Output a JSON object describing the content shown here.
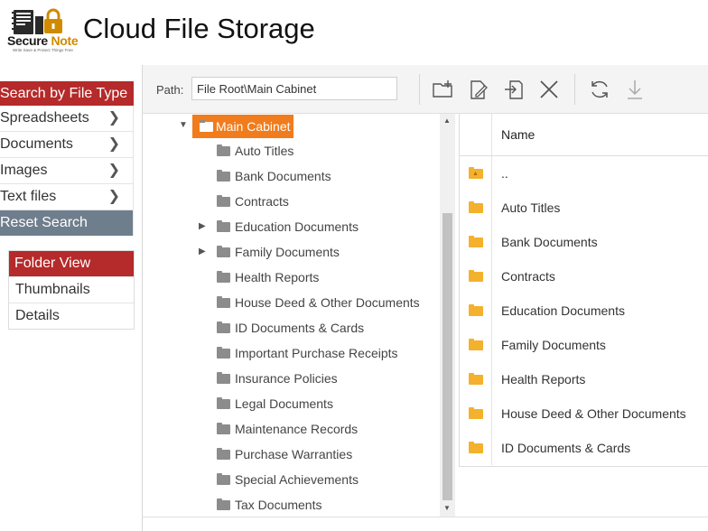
{
  "header": {
    "logo_word1": "Secure",
    "logo_word2": "Note",
    "logo_tagline": "Write Save & Protect Things Free",
    "title": "Cloud File Storage"
  },
  "search_menu": {
    "heading": "Search by File Type",
    "items": [
      {
        "label": "Spreadsheets"
      },
      {
        "label": "Documents"
      },
      {
        "label": "Images"
      },
      {
        "label": "Text files"
      }
    ],
    "reset_label": "Reset Search"
  },
  "view_menu": {
    "heading": "Folder View",
    "items": [
      {
        "label": "Thumbnails"
      },
      {
        "label": "Details"
      }
    ]
  },
  "toolbar": {
    "path_label": "Path:",
    "path_value": "File Root\\Main Cabinet",
    "buttons": [
      "new-folder-icon",
      "rename-icon",
      "move-icon",
      "delete-icon",
      "refresh-icon",
      "download-icon"
    ]
  },
  "tree": {
    "root": "Main Cabinet",
    "children": [
      {
        "label": "Auto Titles",
        "expandable": false
      },
      {
        "label": "Bank Documents",
        "expandable": false
      },
      {
        "label": "Contracts",
        "expandable": false
      },
      {
        "label": "Education Documents",
        "expandable": true
      },
      {
        "label": "Family Documents",
        "expandable": true
      },
      {
        "label": "Health Reports",
        "expandable": false
      },
      {
        "label": "House Deed & Other Documents",
        "expandable": false
      },
      {
        "label": "ID Documents & Cards",
        "expandable": false
      },
      {
        "label": "Important Purchase Receipts",
        "expandable": false
      },
      {
        "label": "Insurance Policies",
        "expandable": false
      },
      {
        "label": "Legal Documents",
        "expandable": false
      },
      {
        "label": "Maintenance Records",
        "expandable": false
      },
      {
        "label": "Purchase Warranties",
        "expandable": false
      },
      {
        "label": "Special Achievements",
        "expandable": false
      },
      {
        "label": "Tax Documents",
        "expandable": false
      }
    ]
  },
  "grid": {
    "column_name": "Name",
    "rows": [
      {
        "name": ".."
      },
      {
        "name": "Auto Titles"
      },
      {
        "name": "Bank Documents"
      },
      {
        "name": "Contracts"
      },
      {
        "name": "Education Documents"
      },
      {
        "name": "Family Documents"
      },
      {
        "name": "Health Reports"
      },
      {
        "name": "House Deed & Other Documents"
      },
      {
        "name": "ID Documents & Cards"
      }
    ]
  },
  "colors": {
    "accent_red": "#b52a2a",
    "reset_slate": "#6f7e8c",
    "selected_orange": "#f07c1d",
    "folder_yellow": "#f3b12d",
    "folder_gray": "#8c8c8c"
  }
}
